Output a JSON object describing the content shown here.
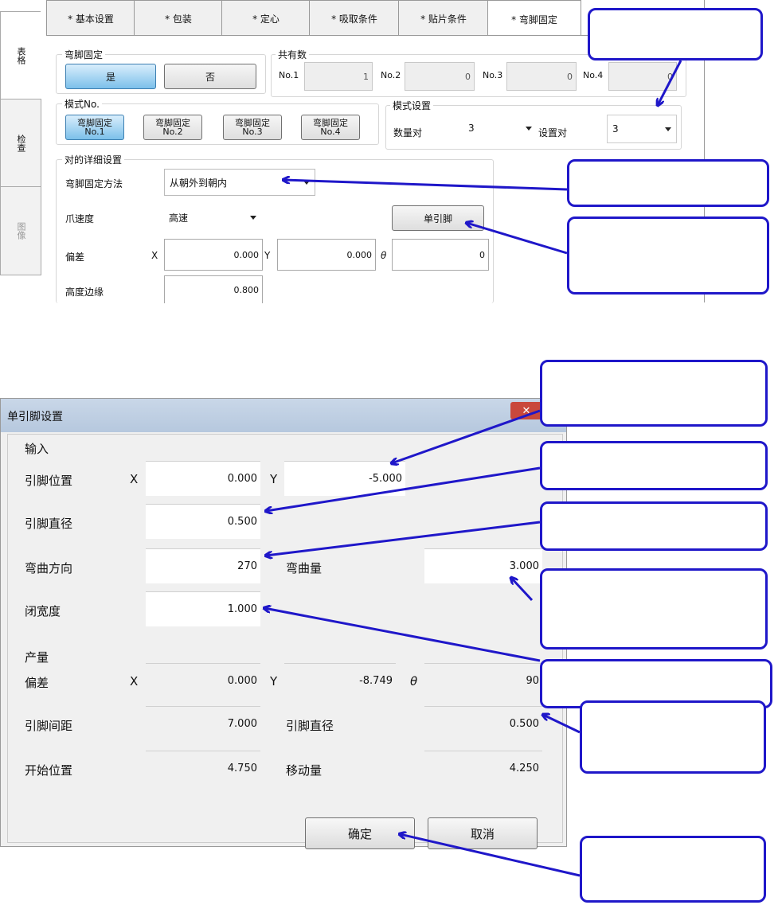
{
  "top": {
    "side_tabs": [
      "表格",
      "检查",
      "图像"
    ],
    "tabs": [
      "* 基本设置",
      "* 包装",
      "* 定心",
      "* 吸取条件",
      "* 贴片条件",
      "* 弯脚固定"
    ],
    "lead_clinch_group": "弯脚固定",
    "yes_label": "是",
    "no_label": "否",
    "common_group": "共有数",
    "common_fields": [
      {
        "label": "No.1",
        "value": "1"
      },
      {
        "label": "No.2",
        "value": "0"
      },
      {
        "label": "No.3",
        "value": "0"
      },
      {
        "label": "No.4",
        "value": "0"
      }
    ],
    "pattern_group": "模式No.",
    "pattern_buttons": [
      {
        "line1": "弯脚固定",
        "line2": "No.1"
      },
      {
        "line1": "弯脚固定",
        "line2": "No.2"
      },
      {
        "line1": "弯脚固定",
        "line2": "No.3"
      },
      {
        "line1": "弯脚固定",
        "line2": "No.4"
      }
    ],
    "pattern_setting_group": "模式设置",
    "pair_count_label": "数量对",
    "pair_count_value": "3",
    "set_pair_label": "设置对",
    "set_pair_value": "3",
    "detail_group": "对的详细设置",
    "method_label": "弯脚固定方法",
    "method_value": "从朝外到朝内",
    "claw_speed_label": "爪速度",
    "claw_speed_value": "高速",
    "single_lead_button": "单引脚",
    "offset_label": "偏差",
    "x_label": "X",
    "x_value": "0.000",
    "y_label": "Y",
    "y_value": "0.000",
    "theta_label": "θ",
    "theta_value": "0",
    "height_margin_label": "高度边缘",
    "height_margin_value": "0.800"
  },
  "dialog": {
    "title": "单引脚设置",
    "input_section": "输入",
    "lead_position_label": "引脚位置",
    "x_label": "X",
    "x_value": "0.000",
    "y_label": "Y",
    "y_value": "-5.000",
    "lead_diameter_label": "引脚直径",
    "lead_diameter_value": "0.500",
    "bend_direction_label": "弯曲方向",
    "bend_direction_value": "270",
    "bend_amount_label": "弯曲量",
    "bend_amount_value": "3.000",
    "close_width_label": "闭宽度",
    "close_width_value": "1.000",
    "output_section": "产量",
    "offset_label": "偏差",
    "out_x_label": "X",
    "out_x_value": "0.000",
    "out_y_label": "Y",
    "out_y_value": "-8.749",
    "theta_label": "θ",
    "theta_value": "90",
    "lead_pitch_label": "引脚间距",
    "lead_pitch_value": "7.000",
    "out_diameter_label": "引脚直径",
    "out_diameter_value": "0.500",
    "start_position_label": "开始位置",
    "start_position_value": "4.750",
    "move_amount_label": "移动量",
    "move_amount_value": "4.250",
    "ok_button": "确定",
    "cancel_button": "取消"
  },
  "colors": {
    "callout_border": "#1f17c9",
    "selected_button": "#7cc0ea",
    "title_bar": "#c9d7e8",
    "close_button": "#c9483c"
  },
  "icons": [
    "dropdown-arrow-icon",
    "close-icon"
  ]
}
